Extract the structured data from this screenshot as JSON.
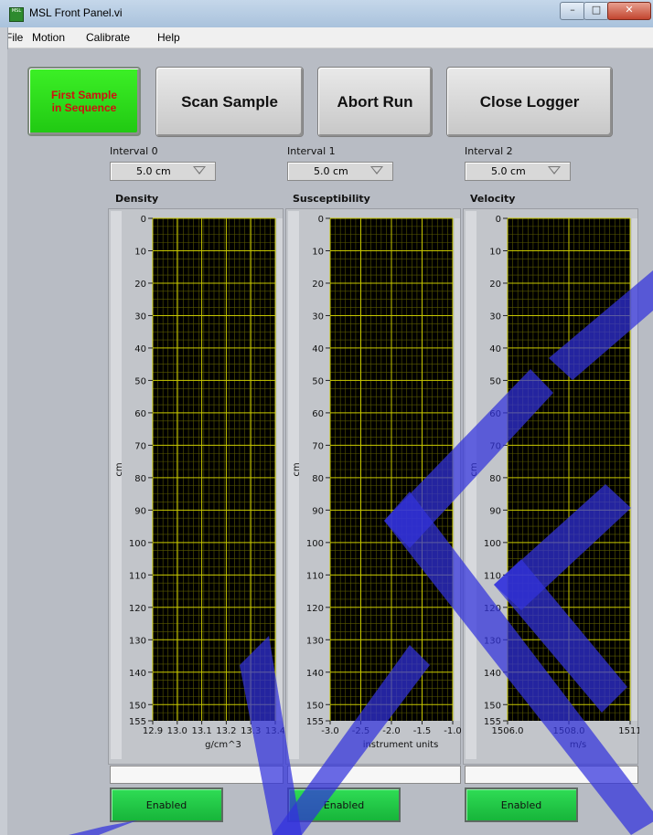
{
  "window": {
    "title": "MSL Front Panel.vi",
    "icon_text": "MSL"
  },
  "menu": [
    "File",
    "Motion",
    "Calibrate",
    "Help"
  ],
  "buttons": {
    "first_sample_line1": "First Sample",
    "first_sample_line2": "in Sequence",
    "scan": "Scan Sample",
    "abort": "Abort Run",
    "close": "Close Logger"
  },
  "intervals": [
    {
      "label": "Interval 0",
      "value": "5.0 cm"
    },
    {
      "label": "Interval 1",
      "value": "5.0 cm"
    },
    {
      "label": "Interval 2",
      "value": "5.0 cm"
    }
  ],
  "enabled_labels": [
    "Enabled",
    "Enabled",
    "Enabled"
  ],
  "colors": {
    "plot_bg": "#000000",
    "grid_major": "#c8c800",
    "grid_minor": "#5a5a00",
    "first_sample": "#33e31f",
    "first_sample_text": "#d01010",
    "enabled": "#22c846",
    "watermark": "#3232dc"
  },
  "chart_data": [
    {
      "type": "line",
      "title": "Density",
      "ylabel": "cm",
      "xlabel": "g/cm^3",
      "ylim": [
        0,
        155
      ],
      "y_ticks": [
        0,
        10,
        20,
        30,
        40,
        50,
        60,
        70,
        80,
        90,
        100,
        110,
        120,
        130,
        140,
        150,
        155
      ],
      "xlim": [
        12.9,
        13.4
      ],
      "x_ticks": [
        "12.9",
        "13.0",
        "13.1",
        "13.2",
        "13.3",
        "13.4"
      ],
      "series": []
    },
    {
      "type": "line",
      "title": "Susceptibility",
      "ylabel": "cm",
      "xlabel": "instrument units",
      "ylim": [
        0,
        155
      ],
      "y_ticks": [
        0,
        10,
        20,
        30,
        40,
        50,
        60,
        70,
        80,
        90,
        100,
        110,
        120,
        130,
        140,
        150,
        155
      ],
      "xlim": [
        -3.0,
        -1.0
      ],
      "x_ticks": [
        "-3.0",
        "-2.5",
        "-2.0",
        "-1.5",
        "-1.0"
      ],
      "series": []
    },
    {
      "type": "line",
      "title": "Velocity",
      "ylabel": "cm",
      "xlabel": "m/s",
      "ylim": [
        0,
        155
      ],
      "y_ticks": [
        0,
        10,
        20,
        30,
        40,
        50,
        60,
        70,
        80,
        90,
        100,
        110,
        120,
        130,
        140,
        150,
        155
      ],
      "xlim": [
        1506.0,
        1511
      ],
      "x_ticks": [
        "1506.0",
        "1508.0",
        "1511"
      ],
      "series": []
    }
  ]
}
